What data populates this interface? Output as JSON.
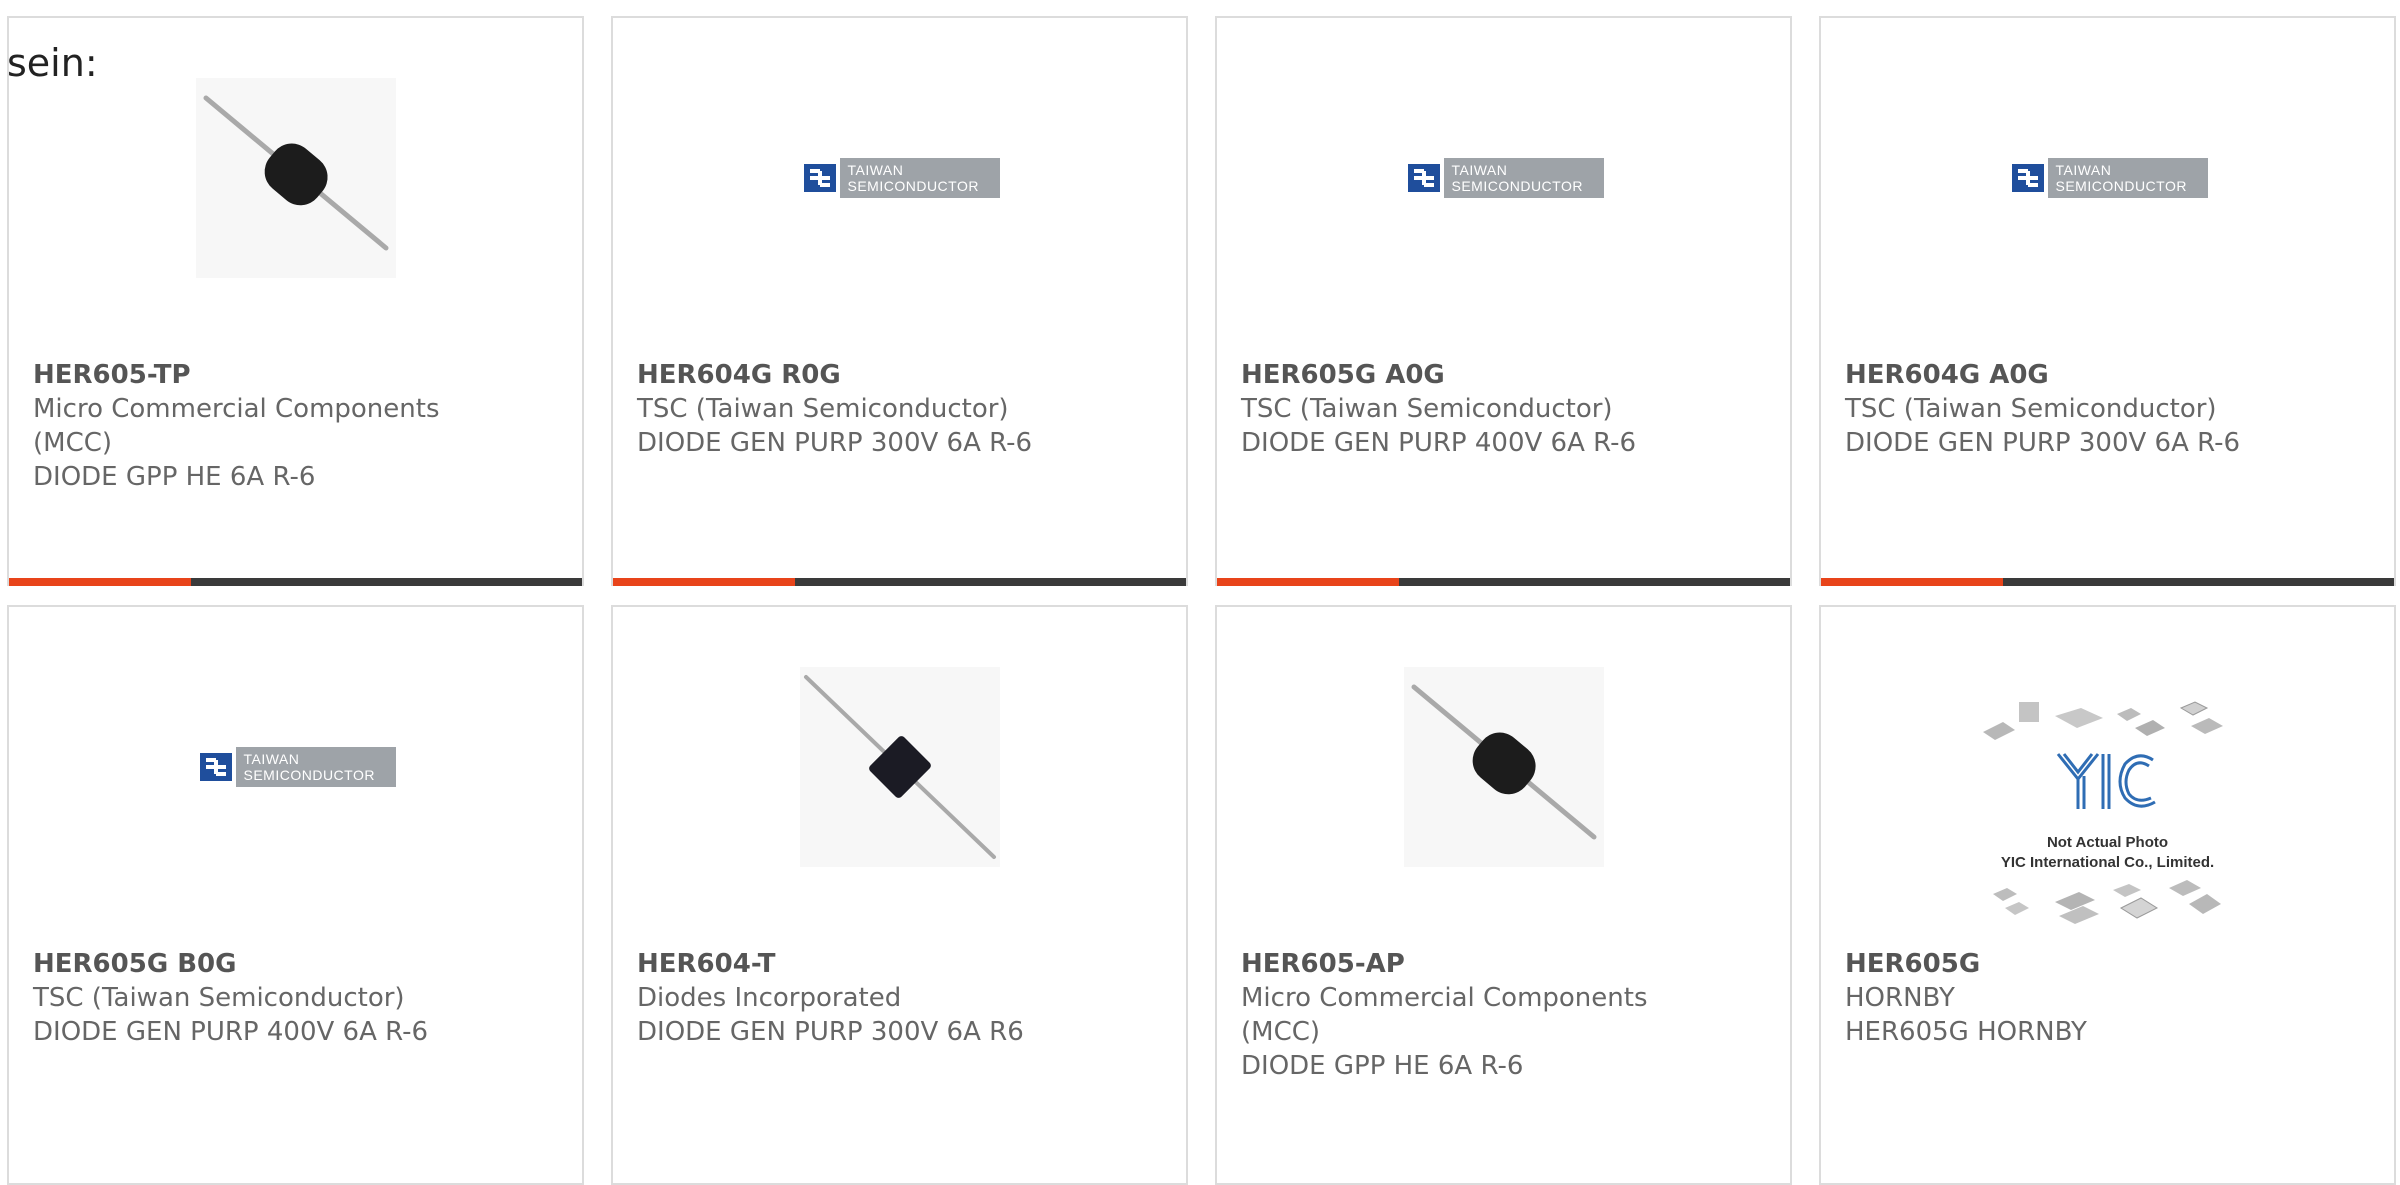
{
  "heading": "sein:",
  "products": [
    {
      "part": "HER605-TP",
      "lines": [
        "Micro Commercial Components",
        "(MCC)"
      ],
      "description": "DIODE GPP HE 6A R-6",
      "image": "diode-photo",
      "logo": {}
    },
    {
      "part": "HER604G R0G",
      "lines": [
        "TSC (Taiwan Semiconductor)"
      ],
      "description": "DIODE GEN PURP 300V 6A R-6",
      "image": "taiwan-semiconductor-logo",
      "logo": {
        "line1": "TAIWAN",
        "line2": "SEMICONDUCTOR"
      }
    },
    {
      "part": "HER605G A0G",
      "lines": [
        "TSC (Taiwan Semiconductor)"
      ],
      "description": "DIODE GEN PURP 400V 6A R-6",
      "image": "taiwan-semiconductor-logo",
      "logo": {
        "line1": "TAIWAN",
        "line2": "SEMICONDUCTOR"
      }
    },
    {
      "part": "HER604G A0G",
      "lines": [
        "TSC (Taiwan Semiconductor)"
      ],
      "description": "DIODE GEN PURP 300V 6A R-6",
      "image": "taiwan-semiconductor-logo",
      "logo": {
        "line1": "TAIWAN",
        "line2": "SEMICONDUCTOR"
      }
    },
    {
      "part": "HER605G B0G",
      "lines": [
        "TSC (Taiwan Semiconductor)"
      ],
      "description": "DIODE GEN PURP 400V 6A R-6",
      "image": "taiwan-semiconductor-logo",
      "logo": {
        "line1": "TAIWAN",
        "line2": "SEMICONDUCTOR"
      }
    },
    {
      "part": "HER604-T",
      "lines": [
        "Diodes Incorporated"
      ],
      "description": "DIODE GEN PURP 300V 6A R6",
      "image": "diode-photo-square",
      "logo": {}
    },
    {
      "part": "HER605-AP",
      "lines": [
        "Micro Commercial Components",
        "(MCC)"
      ],
      "description": "DIODE GPP HE 6A R-6",
      "image": "diode-photo",
      "logo": {}
    },
    {
      "part": "HER605G",
      "lines": [
        "HORNBY"
      ],
      "description": "HER605G HORNBY",
      "image": "yic-placeholder",
      "logo": {
        "brand": "YIC",
        "caption1": "Not Actual Photo",
        "caption2": "YIC International Co., Limited."
      }
    }
  ],
  "colors": {
    "accent": "#e8441a",
    "bar_dark": "#3a3a3a",
    "text_grey": "#666666",
    "tsc_blue": "#1f4e9c",
    "tsc_grey": "#9ea3a8"
  }
}
